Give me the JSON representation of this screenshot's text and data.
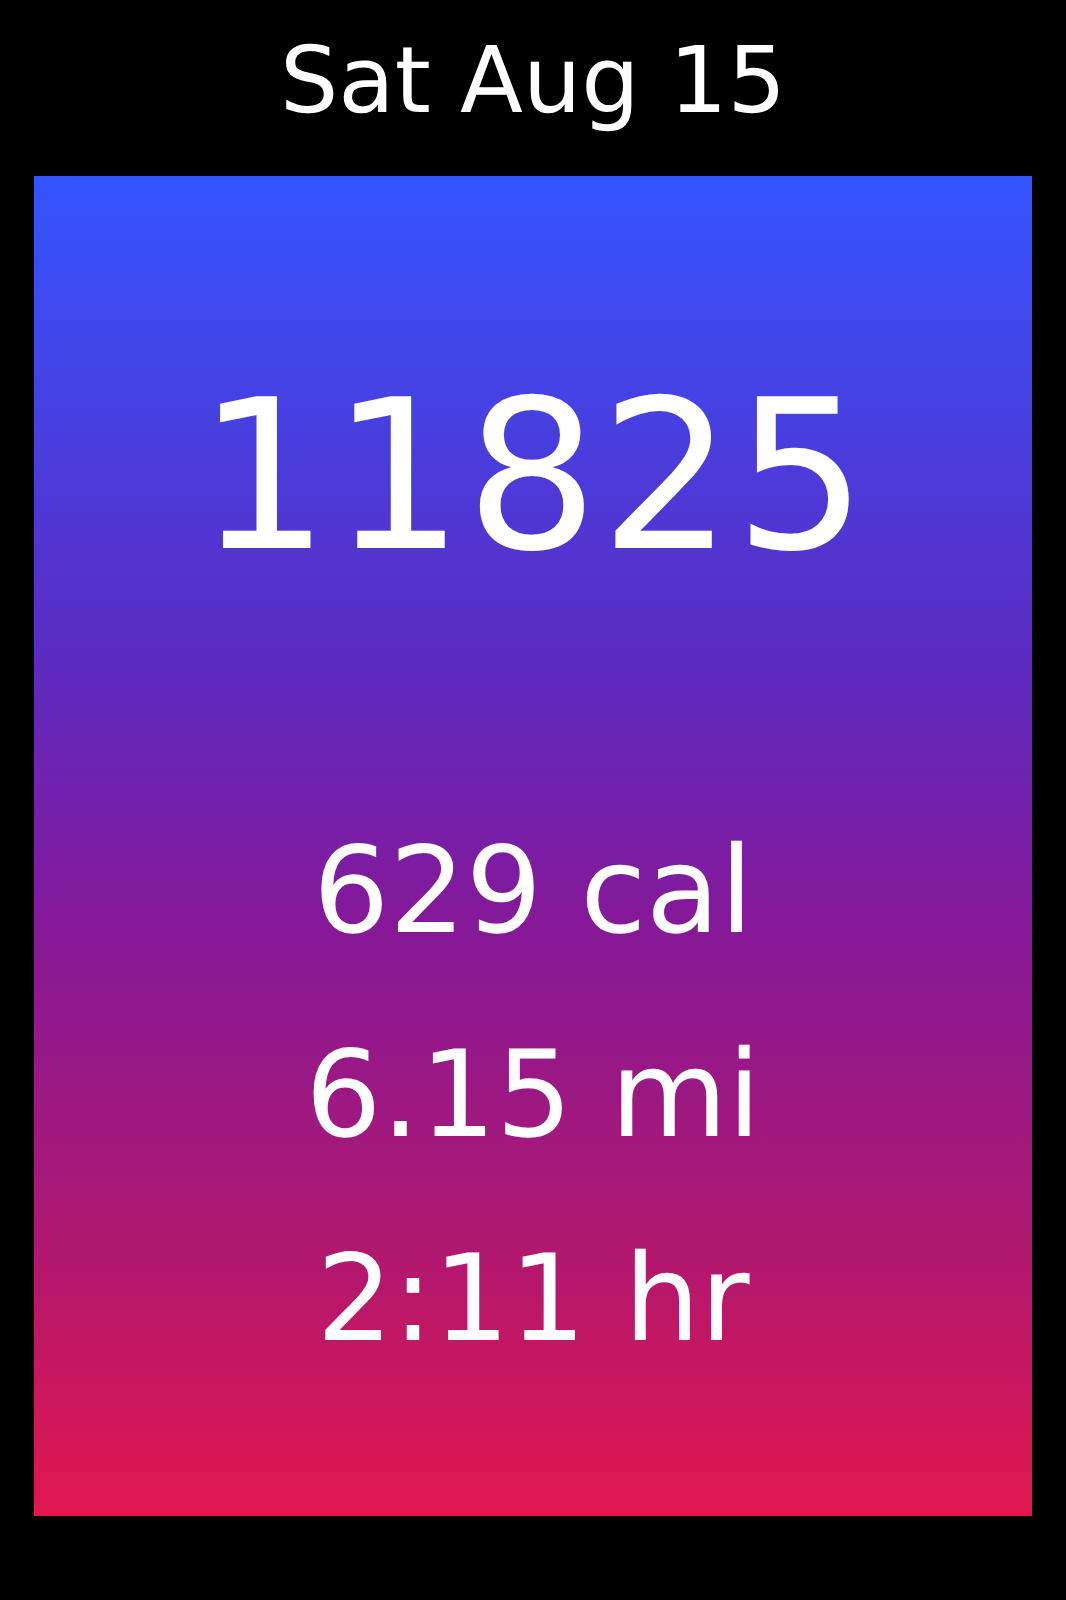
{
  "date": "Sat Aug 15",
  "steps": "11825",
  "stats": [
    "629 cal",
    "6.15 mi",
    "2:11 hr"
  ]
}
